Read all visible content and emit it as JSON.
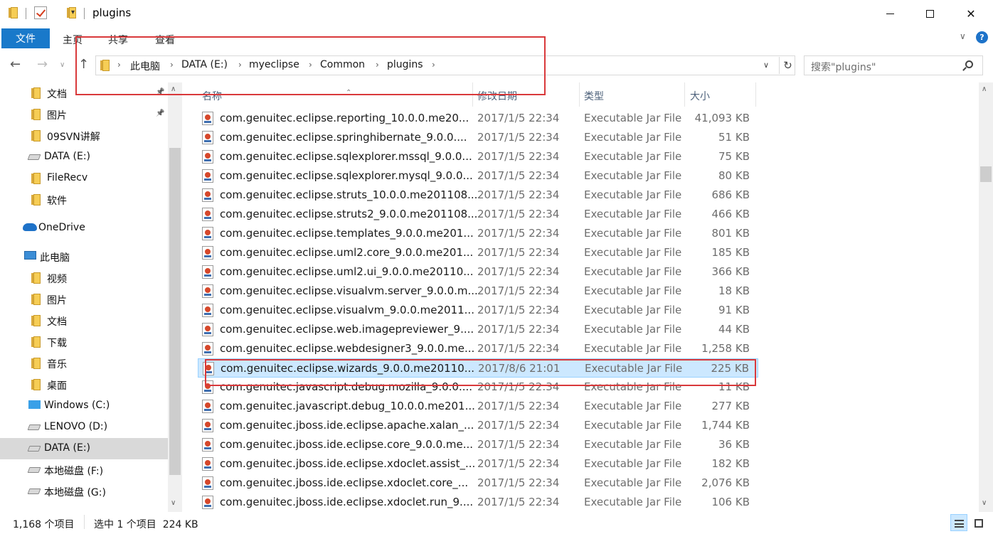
{
  "window": {
    "title": "plugins",
    "qa_arrow": "▾",
    "min": "",
    "close": "✕"
  },
  "ribbon": {
    "tabs": [
      "文件",
      "主页",
      "共享",
      "查看"
    ],
    "chevron": "∨",
    "help": "?"
  },
  "address": {
    "crumbs": [
      "此电脑",
      "DATA (E:)",
      "myeclipse",
      "Common",
      "plugins"
    ],
    "separator": "›",
    "search_placeholder": "搜索\"plugins\""
  },
  "nav": {
    "items": [
      {
        "label": "文档",
        "icon": "folder-icon",
        "pinned": true
      },
      {
        "label": "图片",
        "icon": "folder-icon",
        "pinned": true
      },
      {
        "label": "09SVN讲解",
        "icon": "folder-icon",
        "pinned": false
      },
      {
        "label": "DATA (E:)",
        "icon": "drive-icon",
        "pinned": false
      },
      {
        "label": "FileRecv",
        "icon": "folder-icon",
        "pinned": false
      },
      {
        "label": "软件",
        "icon": "folder-icon",
        "pinned": false
      },
      {
        "label": "OneDrive",
        "icon": "onedrive-icon",
        "pinned": false
      },
      {
        "label": "此电脑",
        "icon": "computer-icon",
        "pinned": false
      },
      {
        "label": "视频",
        "icon": "video-folder-icon",
        "pinned": false
      },
      {
        "label": "图片",
        "icon": "pictures-folder-icon",
        "pinned": false
      },
      {
        "label": "文档",
        "icon": "documents-folder-icon",
        "pinned": false
      },
      {
        "label": "下载",
        "icon": "downloads-folder-icon",
        "pinned": false
      },
      {
        "label": "音乐",
        "icon": "music-folder-icon",
        "pinned": false
      },
      {
        "label": "桌面",
        "icon": "desktop-folder-icon",
        "pinned": false
      },
      {
        "label": "Windows (C:)",
        "icon": "windows-drive-icon",
        "pinned": false
      },
      {
        "label": "LENOVO (D:)",
        "icon": "drive-icon",
        "pinned": false
      },
      {
        "label": "DATA (E:)",
        "icon": "drive-icon",
        "pinned": false,
        "selected": true
      },
      {
        "label": "本地磁盘 (F:)",
        "icon": "drive-icon",
        "pinned": false
      },
      {
        "label": "本地磁盘 (G:)",
        "icon": "drive-icon",
        "pinned": false
      }
    ]
  },
  "columns": {
    "name": "名称",
    "date": "修改日期",
    "type": "类型",
    "size": "大小"
  },
  "files": [
    {
      "name": "com.genuitec.eclipse.reporting_10.0.0.me20...",
      "date": "2017/1/5 22:34",
      "type": "Executable Jar File",
      "size": "41,093 KB"
    },
    {
      "name": "com.genuitec.eclipse.springhibernate_9.0.0....",
      "date": "2017/1/5 22:34",
      "type": "Executable Jar File",
      "size": "51 KB"
    },
    {
      "name": "com.genuitec.eclipse.sqlexplorer.mssql_9.0.0...",
      "date": "2017/1/5 22:34",
      "type": "Executable Jar File",
      "size": "75 KB"
    },
    {
      "name": "com.genuitec.eclipse.sqlexplorer.mysql_9.0.0...",
      "date": "2017/1/5 22:34",
      "type": "Executable Jar File",
      "size": "80 KB"
    },
    {
      "name": "com.genuitec.eclipse.struts_10.0.0.me201108...",
      "date": "2017/1/5 22:34",
      "type": "Executable Jar File",
      "size": "686 KB"
    },
    {
      "name": "com.genuitec.eclipse.struts2_9.0.0.me201108...",
      "date": "2017/1/5 22:34",
      "type": "Executable Jar File",
      "size": "466 KB"
    },
    {
      "name": "com.genuitec.eclipse.templates_9.0.0.me201...",
      "date": "2017/1/5 22:34",
      "type": "Executable Jar File",
      "size": "801 KB"
    },
    {
      "name": "com.genuitec.eclipse.uml2.core_9.0.0.me201...",
      "date": "2017/1/5 22:34",
      "type": "Executable Jar File",
      "size": "185 KB"
    },
    {
      "name": "com.genuitec.eclipse.uml2.ui_9.0.0.me20110...",
      "date": "2017/1/5 22:34",
      "type": "Executable Jar File",
      "size": "366 KB"
    },
    {
      "name": "com.genuitec.eclipse.visualvm.server_9.0.0.m...",
      "date": "2017/1/5 22:34",
      "type": "Executable Jar File",
      "size": "18 KB"
    },
    {
      "name": "com.genuitec.eclipse.visualvm_9.0.0.me2011...",
      "date": "2017/1/5 22:34",
      "type": "Executable Jar File",
      "size": "91 KB"
    },
    {
      "name": "com.genuitec.eclipse.web.imagepreviewer_9....",
      "date": "2017/1/5 22:34",
      "type": "Executable Jar File",
      "size": "44 KB"
    },
    {
      "name": "com.genuitec.eclipse.webdesigner3_9.0.0.me...",
      "date": "2017/1/5 22:34",
      "type": "Executable Jar File",
      "size": "1,258 KB"
    },
    {
      "name": "com.genuitec.eclipse.wizards_9.0.0.me20110...",
      "date": "2017/8/6 21:01",
      "type": "Executable Jar File",
      "size": "225 KB",
      "selected": true
    },
    {
      "name": "com.genuitec.javascript.debug.mozilla_9.0.0....",
      "date": "2017/1/5 22:34",
      "type": "Executable Jar File",
      "size": "11 KB"
    },
    {
      "name": "com.genuitec.javascript.debug_10.0.0.me201...",
      "date": "2017/1/5 22:34",
      "type": "Executable Jar File",
      "size": "277 KB"
    },
    {
      "name": "com.genuitec.jboss.ide.eclipse.apache.xalan_...",
      "date": "2017/1/5 22:34",
      "type": "Executable Jar File",
      "size": "1,744 KB"
    },
    {
      "name": "com.genuitec.jboss.ide.eclipse.core_9.0.0.me...",
      "date": "2017/1/5 22:34",
      "type": "Executable Jar File",
      "size": "36 KB"
    },
    {
      "name": "com.genuitec.jboss.ide.eclipse.xdoclet.assist_...",
      "date": "2017/1/5 22:34",
      "type": "Executable Jar File",
      "size": "182 KB"
    },
    {
      "name": "com.genuitec.jboss.ide.eclipse.xdoclet.core_...",
      "date": "2017/1/5 22:34",
      "type": "Executable Jar File",
      "size": "2,076 KB"
    },
    {
      "name": "com.genuitec.jboss.ide.eclipse.xdoclet.run_9....",
      "date": "2017/1/5 22:34",
      "type": "Executable Jar File",
      "size": "106 KB"
    }
  ],
  "status": {
    "count": "1,168 个项目",
    "selection": "选中 1 个项目  224 KB"
  },
  "colors": {
    "accent": "#1979ca",
    "selection": "#cce8ff",
    "annotation": "#d9393b"
  }
}
